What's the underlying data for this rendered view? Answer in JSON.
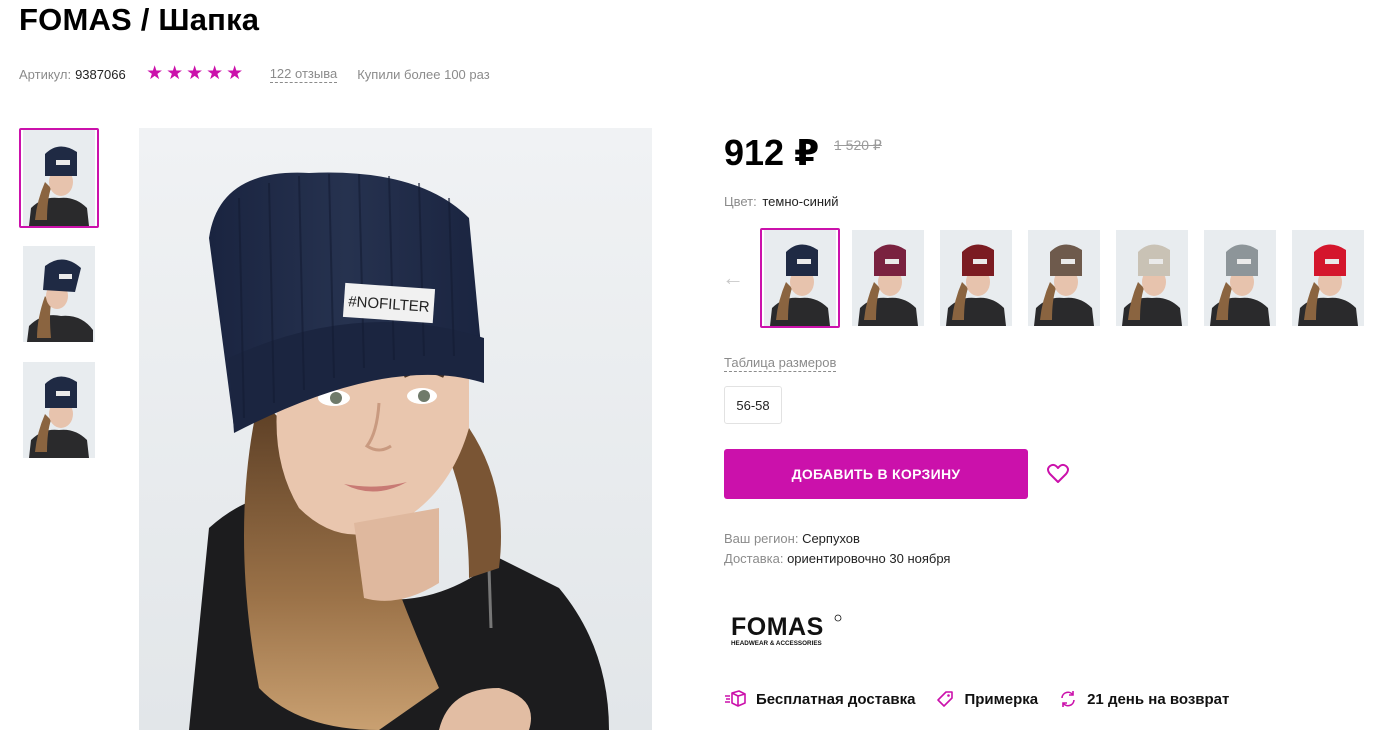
{
  "product": {
    "title": "FOMAS / Шапка",
    "article_label": "Артикул:",
    "article_value": "9387066",
    "rating": 5,
    "reviews": "122 отзыва",
    "bought": "Купили более 100 раз"
  },
  "gallery": {
    "thumbs": [
      {
        "name": "thumb-1",
        "active": true,
        "hat": "#1f2a44"
      },
      {
        "name": "thumb-2",
        "active": false,
        "hat": "#1f2a44"
      },
      {
        "name": "thumb-3",
        "active": false,
        "hat": "#1f2a44"
      }
    ],
    "main_label": "#NOFILTER"
  },
  "price": {
    "current": "912 ₽",
    "old": "1 520 ₽"
  },
  "color": {
    "label": "Цвет:",
    "value": "темно-синий",
    "swatches": [
      {
        "name": "темно-синий",
        "hat": "#1f2a44",
        "active": true
      },
      {
        "name": "бордовый-светлый",
        "hat": "#7a2240",
        "active": false
      },
      {
        "name": "бордовый",
        "hat": "#7b1c22",
        "active": false
      },
      {
        "name": "коричневый",
        "hat": "#6e5a4c",
        "active": false
      },
      {
        "name": "бежевый",
        "hat": "#c9c2b5",
        "active": false
      },
      {
        "name": "серый",
        "hat": "#8d9599",
        "active": false
      },
      {
        "name": "красный",
        "hat": "#d4162c",
        "active": false
      }
    ]
  },
  "sizes": {
    "table_link": "Таблица размеров",
    "options": [
      "56-58"
    ]
  },
  "actions": {
    "add_to_cart": "ДОБАВИТЬ В КОРЗИНУ"
  },
  "delivery": {
    "region_label": "Ваш регион:",
    "region_value": "Серпухов",
    "delivery_label": "Доставка:",
    "delivery_value": "ориентировочно 30 ноября"
  },
  "brand": {
    "name": "FOMAS",
    "tagline": "HEADWEAR & ACCESSORIES"
  },
  "perks": [
    {
      "icon": "delivery-box-icon",
      "label": "Бесплатная доставка"
    },
    {
      "icon": "tag-icon",
      "label": "Примерка"
    },
    {
      "icon": "return-arrows-icon",
      "label": "21 день на возврат"
    }
  ],
  "colors": {
    "accent": "#cb11ab"
  }
}
